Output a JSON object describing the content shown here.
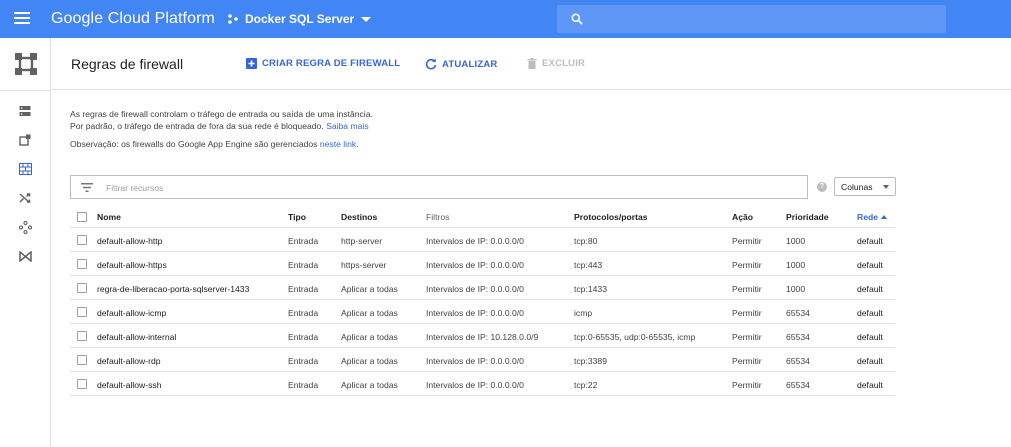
{
  "topbar": {
    "brand": "Google Cloud Platform",
    "project": "Docker SQL Server",
    "colors": {
      "bar": "#4285f4",
      "search": "#5e97f6"
    }
  },
  "nav": {
    "icons": [
      "compute-engine-icon",
      "instances-icon",
      "snapshot-icon",
      "firewall-icon",
      "routes-icon",
      "network-icon",
      "vpn-icon"
    ]
  },
  "header": {
    "title": "Regras de firewall",
    "create_label": "CRIAR REGRA DE FIREWALL",
    "refresh_label": "ATUALIZAR",
    "delete_label": "EXCLUIR"
  },
  "intro": {
    "line1": "As regras de firewall controlam o tráfego de entrada ou saída de uma instância.",
    "line2": "Por padrão, o tráfego de entrada de fora da sua rede é bloqueado.",
    "learn_more": "Saiba mais",
    "note": "Observação: os firewalls do Google App Engine são gerenciados",
    "note_link": "neste link",
    "note_end": "."
  },
  "filter": {
    "placeholder": "Filtrar recursos",
    "help": "?",
    "columns_label": "Colunas"
  },
  "table": {
    "headers": {
      "name": "Nome",
      "type": "Tipo",
      "targets": "Destinos",
      "filters": "Filtros",
      "protocols": "Protocolos/portas",
      "action": "Ação",
      "priority": "Prioridade",
      "network": "Rede"
    },
    "rows": [
      {
        "name": "default-allow-http",
        "type": "Entrada",
        "targets": "http-server",
        "filters": "Intervalos de IP: 0.0.0.0/0",
        "protocols": "tcp:80",
        "action": "Permitir",
        "priority": "1000",
        "network": "default"
      },
      {
        "name": "default-allow-https",
        "type": "Entrada",
        "targets": "https-server",
        "filters": "Intervalos de IP: 0.0.0.0/0",
        "protocols": "tcp:443",
        "action": "Permitir",
        "priority": "1000",
        "network": "default"
      },
      {
        "name": "regra-de-liberacao-porta-sqlserver-1433",
        "type": "Entrada",
        "targets": "Aplicar a todas",
        "filters": "Intervalos de IP: 0.0.0.0/0",
        "protocols": "tcp:1433",
        "action": "Permitir",
        "priority": "1000",
        "network": "default"
      },
      {
        "name": "default-allow-icmp",
        "type": "Entrada",
        "targets": "Aplicar a todas",
        "filters": "Intervalos de IP: 0.0.0.0/0",
        "protocols": "icmp",
        "action": "Permitir",
        "priority": "65534",
        "network": "default"
      },
      {
        "name": "default-allow-internal",
        "type": "Entrada",
        "targets": "Aplicar a todas",
        "filters": "Intervalos de IP: 10.128.0.0/9",
        "protocols": "tcp:0-65535, udp:0-65535, icmp",
        "action": "Permitir",
        "priority": "65534",
        "network": "default"
      },
      {
        "name": "default-allow-rdp",
        "type": "Entrada",
        "targets": "Aplicar a todas",
        "filters": "Intervalos de IP: 0.0.0.0/0",
        "protocols": "tcp:3389",
        "action": "Permitir",
        "priority": "65534",
        "network": "default"
      },
      {
        "name": "default-allow-ssh",
        "type": "Entrada",
        "targets": "Aplicar a todas",
        "filters": "Intervalos de IP: 0.0.0.0/0",
        "protocols": "tcp:22",
        "action": "Permitir",
        "priority": "65534",
        "network": "default"
      }
    ]
  }
}
